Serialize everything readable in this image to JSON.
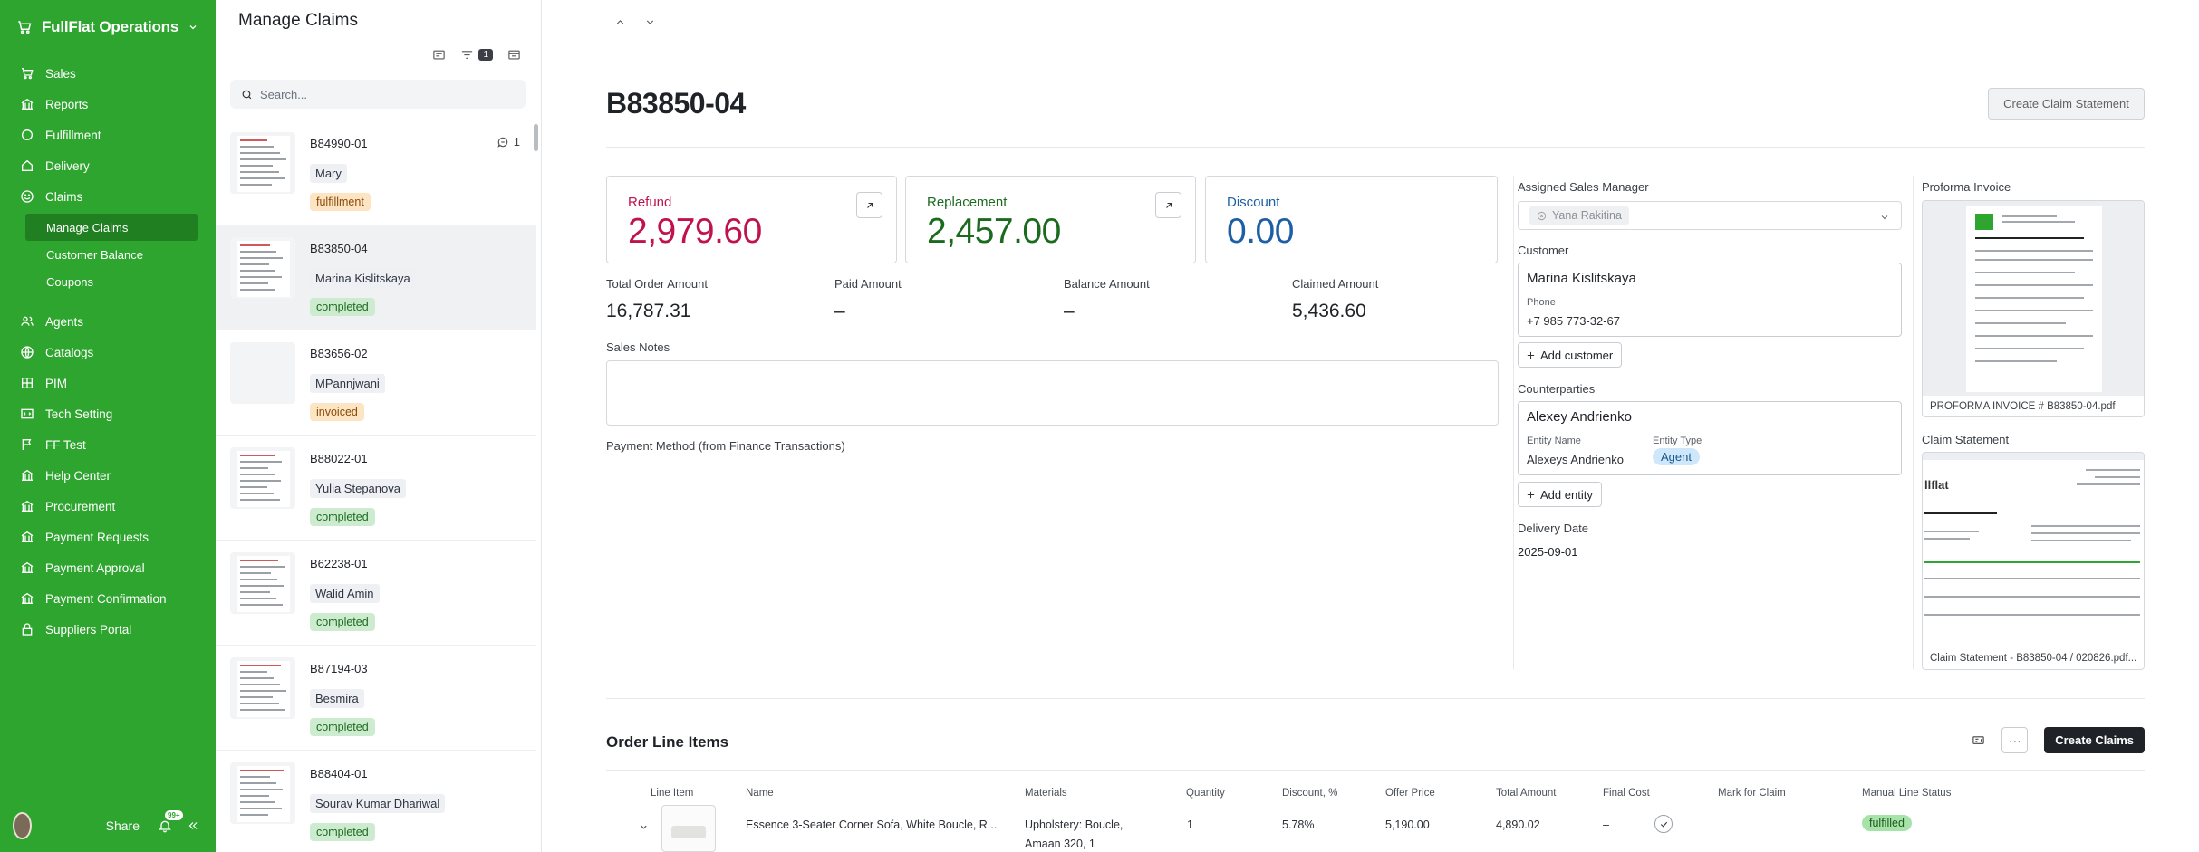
{
  "sidebar": {
    "title": "FullFlat Operations",
    "items": [
      {
        "label": "Sales",
        "icon": "cart-icon"
      },
      {
        "label": "Reports",
        "icon": "bank-icon"
      },
      {
        "label": "Fulfillment",
        "icon": "circle-icon"
      },
      {
        "label": "Delivery",
        "icon": "home-icon"
      },
      {
        "label": "Claims",
        "icon": "smile-icon"
      }
    ],
    "claims_sub": [
      {
        "label": "Manage Claims",
        "active": true
      },
      {
        "label": "Customer Balance",
        "active": false
      },
      {
        "label": "Coupons",
        "active": false
      }
    ],
    "items2": [
      {
        "label": "Agents",
        "icon": "users-icon"
      },
      {
        "label": "Catalogs",
        "icon": "globe-icon"
      },
      {
        "label": "PIM",
        "icon": "grid-icon"
      },
      {
        "label": "Tech Setting",
        "icon": "code-icon"
      },
      {
        "label": "FF Test",
        "icon": "flag-icon"
      },
      {
        "label": "Help Center",
        "icon": "bank-icon"
      },
      {
        "label": "Procurement",
        "icon": "bank-icon"
      },
      {
        "label": "Payment Requests",
        "icon": "bank-icon"
      },
      {
        "label": "Payment Approval",
        "icon": "bank-icon"
      },
      {
        "label": "Payment Confirmation",
        "icon": "bank-icon"
      },
      {
        "label": "Suppliers Portal",
        "icon": "lock-icon"
      }
    ],
    "share_label": "Share",
    "notifications_badge": "99+"
  },
  "list": {
    "title": "Manage Claims",
    "filter_count": "1",
    "search_placeholder": "Search...",
    "claims": [
      {
        "id": "B84990-01",
        "name": "Mary",
        "status": "fulfillment",
        "status_color": "orange",
        "comments": "1",
        "has_thumb": true
      },
      {
        "id": "B83850-04",
        "name": "Marina Kislitskaya",
        "status": "completed",
        "status_color": "green",
        "comments": "",
        "has_thumb": true
      },
      {
        "id": "B83656-02",
        "name": "MPannjwani",
        "status": "invoiced",
        "status_color": "orange",
        "comments": "",
        "has_thumb": false
      },
      {
        "id": "B88022-01",
        "name": "Yulia Stepanova",
        "status": "completed",
        "status_color": "green",
        "comments": "",
        "has_thumb": true
      },
      {
        "id": "B62238-01",
        "name": "Walid Amin",
        "status": "completed",
        "status_color": "green",
        "comments": "",
        "has_thumb": true
      },
      {
        "id": "B87194-03",
        "name": "Besmira",
        "status": "completed",
        "status_color": "green",
        "comments": "",
        "has_thumb": true
      },
      {
        "id": "B88404-01",
        "name": "Sourav Kumar Dhariwal",
        "status": "completed",
        "status_color": "green",
        "comments": "",
        "has_thumb": true
      }
    ]
  },
  "main": {
    "title": "B83850-04",
    "create_statement_label": "Create Claim Statement",
    "cards": [
      {
        "label": "Refund",
        "value": "2,979.60",
        "color": "#c0134e",
        "has_link": true
      },
      {
        "label": "Replacement",
        "value": "2,457.00",
        "color": "#1b6b1f",
        "has_link": true
      },
      {
        "label": "Discount",
        "value": "0.00",
        "color": "#1d5fa6",
        "has_link": false
      }
    ],
    "amounts": [
      {
        "label": "Total Order Amount",
        "value": "16,787.31"
      },
      {
        "label": "Paid Amount",
        "value": "–"
      },
      {
        "label": "Balance Amount",
        "value": "–"
      },
      {
        "label": "Claimed Amount",
        "value": "5,436.60"
      }
    ],
    "sales_notes_label": "Sales Notes",
    "payment_method_label": "Payment Method (from Finance Transactions)",
    "assigned_manager_label": "Assigned Sales Manager",
    "assigned_manager_value": "Yana Rakitina",
    "customer_label": "Customer",
    "customer": {
      "name": "Marina Kislitskaya",
      "phone_label": "Phone",
      "phone": "+7 985 773-32-67"
    },
    "add_customer_label": "Add customer",
    "counterparties_label": "Counterparties",
    "counterparty": {
      "name": "Alexey Andrienko",
      "entity_name_label": "Entity Name",
      "entity_name": "Alexeys Andrienko",
      "entity_type_label": "Entity Type",
      "entity_type": "Agent"
    },
    "add_entity_label": "Add entity",
    "delivery_date_label": "Delivery Date",
    "delivery_date": "2025-09-01",
    "proforma_label": "Proforma Invoice",
    "proforma_caption": "PROFORMA INVOICE # B83850-04.pdf",
    "claim_statement_label": "Claim Statement",
    "claim_statement_caption": "Claim Statement - B83850-04 / 020826.pdf...",
    "order_lines_title": "Order Line Items",
    "more_label": "···",
    "create_claims_label": "Create Claims",
    "table": {
      "headers": [
        "Line Item",
        "Name",
        "Materials",
        "Quantity",
        "Discount, %",
        "Offer Price",
        "Total Amount",
        "Final Cost",
        "Mark for Claim",
        "Manual Line Status"
      ],
      "row": {
        "name": "Essence 3-Seater Corner Sofa, White Boucle, R...",
        "materials_1": "Upholstery: Boucle,",
        "materials_2": "Amaan 320, 1",
        "quantity": "1",
        "discount": "5.78%",
        "offer_price": "5,190.00",
        "total_amount": "4,890.02",
        "final_cost": "–",
        "status": "fulfilled"
      }
    }
  }
}
